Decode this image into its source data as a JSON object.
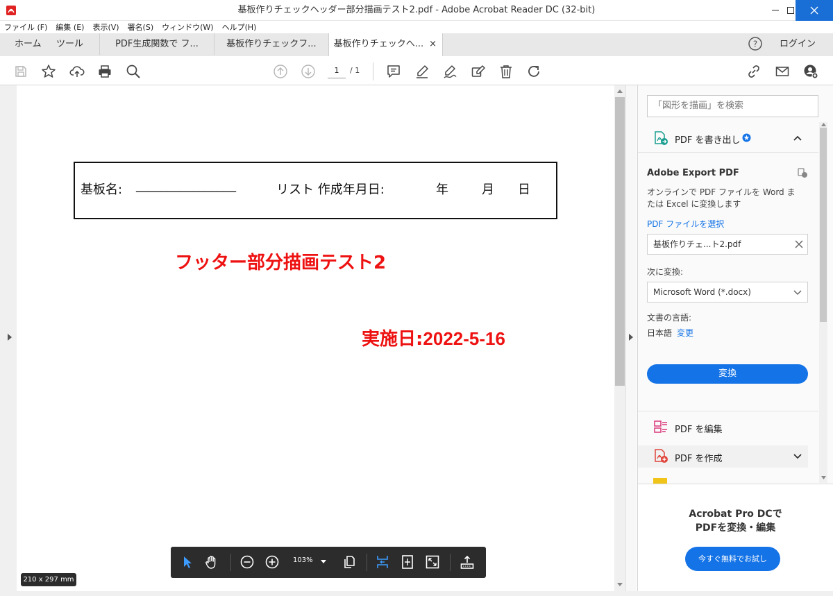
{
  "window": {
    "title": "基板作りチェックヘッダー部分描画テスト2.pdf - Adobe Acrobat Reader DC (32-bit)"
  },
  "menu": [
    "ファイル (F)",
    "編集 (E)",
    "表示(V)",
    "署名(S)",
    "ウィンドウ(W)",
    "ヘルプ(H)"
  ],
  "tabs": {
    "home": "ホーム",
    "tools": "ツール",
    "documents": [
      {
        "label": "PDF生成関数で フ..."
      },
      {
        "label": "基板作りチェックフ..."
      },
      {
        "label": "基板作りチェックへ...",
        "active": true
      }
    ],
    "close_glyph": "×",
    "help_glyph": "?",
    "login": "ログイン"
  },
  "toolbar": {
    "page_current": "1",
    "page_total": "/ 1"
  },
  "document": {
    "header": {
      "board_name_label": "基板名:",
      "board_name_blank": "________________",
      "list_date_label": "リスト 作成年月日:",
      "year": "年",
      "month": "月",
      "day": "日"
    },
    "footer_test": "フッター部分描画テスト2",
    "impl_date_label": "実施日:",
    "impl_date_value": "2022-5-16"
  },
  "floating_toolbar": {
    "zoom": "103%"
  },
  "page_size": "210 x 297 mm",
  "right_panel": {
    "search_placeholder": "「図形を描画」を検索",
    "export_pdf_title": "PDF を書き出し",
    "adobe_export_title": "Adobe Export PDF",
    "description_line1": "オンラインで PDF ファイルを Word ま",
    "description_line2": "たは Excel に変換します",
    "select_file_link": "PDF ファイルを選択",
    "selected_file": "基板作りチェ...ト2.pdf",
    "convert_to_label": "次に変換:",
    "convert_to_value": "Microsoft Word (*.docx)",
    "doc_language_label": "文書の言語:",
    "doc_language_value": "日本語",
    "change_link": "変更",
    "convert_button": "変換",
    "edit_pdf": "PDF を編集",
    "create_pdf": "PDF を作成",
    "promo_line1": "Acrobat Pro DCで",
    "promo_line2": "PDFを変換・編集",
    "trial_button": "今すぐ無料でお試し"
  },
  "colors": {
    "accent": "#1473e6",
    "document_red": "#ee1111",
    "export_teal": "#1a9e8f",
    "edit_pink": "#d9377a",
    "create_red": "#e0443b"
  }
}
